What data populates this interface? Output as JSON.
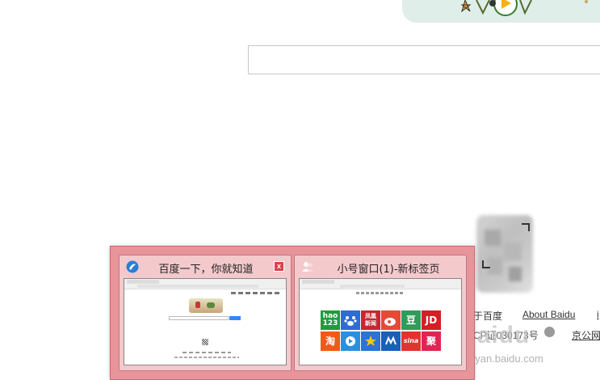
{
  "footer": {
    "about_link_partial": "于百度",
    "about_baidu": "About Baidu",
    "icp_partial": "CP证030173号",
    "beian_partial": "京公网",
    "edge_char": "i"
  },
  "watermark": {
    "brand": "Baidu",
    "domain": "jingyan.baidu.com"
  },
  "preview": {
    "windows": [
      {
        "title": "百度一下，你就知道",
        "icon": "browser-logo-icon",
        "close_label": "x"
      },
      {
        "title": "小号窗口(1)-新标签页",
        "icon": "alt-account-icon"
      }
    ],
    "tiles": [
      {
        "label": "hao\n123",
        "color": "#1e9e3a"
      },
      {
        "label": "",
        "icon": "baidu-paw-icon",
        "color": "#2f6cd3"
      },
      {
        "label": "凤凰\n新闻",
        "color": "#c7282f"
      },
      {
        "label": "",
        "icon": "weibo-icon",
        "color": "#e44a36"
      },
      {
        "label": "豆",
        "color": "#2f9c59"
      },
      {
        "label": "JD",
        "color": "#d61e26"
      },
      {
        "label": "淘",
        "color": "#f15a16"
      },
      {
        "label": "",
        "icon": "video-play-icon",
        "color": "#2b8fe1"
      },
      {
        "label": "",
        "icon": "star-icon",
        "color": "#2c73d4"
      },
      {
        "label": "",
        "icon": "cloud-icon",
        "color": "#1a5fb8"
      },
      {
        "label": "sina",
        "color": "#e2342f"
      },
      {
        "label": "聚",
        "color": "#e02553"
      }
    ]
  },
  "colors": {
    "popup_bg": "#e7959a",
    "popup_border": "#c46f76",
    "close_red": "#d9434b",
    "search_blue": "#3385ff"
  }
}
